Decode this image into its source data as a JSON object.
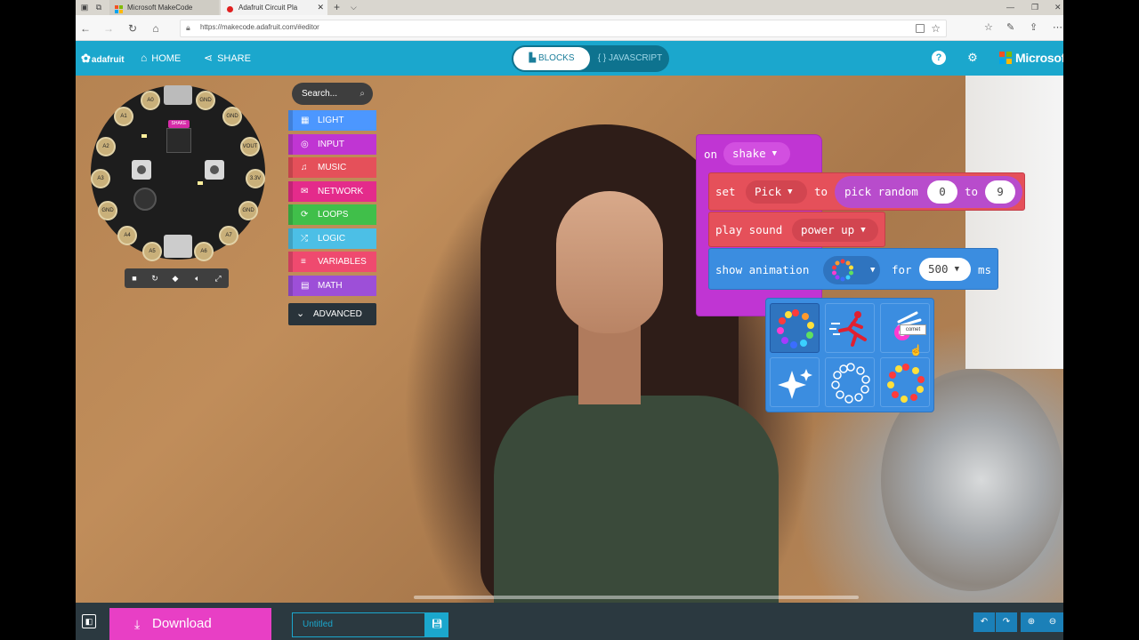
{
  "browser": {
    "tabs": [
      {
        "label": "Microsoft MakeCode"
      },
      {
        "label": "Adafruit Circuit Pla"
      }
    ],
    "new_tab_glyph": "+",
    "url": "https://makecode.adafruit.com/#editor"
  },
  "header": {
    "logo_text": "adafruit",
    "home_label": "HOME",
    "share_label": "SHARE",
    "blocks_label": "BLOCKS",
    "javascript_label": "{ } JAVASCRIPT",
    "microsoft_label": "Microsoft"
  },
  "simulator": {
    "shake_badge": "SHAKE",
    "pads": [
      "A1",
      "A2",
      "A3",
      "GND",
      "A4",
      "A5",
      "A6",
      "A7",
      "GND",
      "3.3V",
      "VOUT",
      "GND",
      "A0",
      "GND"
    ]
  },
  "toolbox": {
    "search_placeholder": "Search...",
    "categories": [
      {
        "label": "LIGHT",
        "color": "#4c97ff"
      },
      {
        "label": "INPUT",
        "color": "#c035d3"
      },
      {
        "label": "MUSIC",
        "color": "#e5505a"
      },
      {
        "label": "NETWORK",
        "color": "#e42b8b"
      },
      {
        "label": "LOOPS",
        "color": "#40bf4a"
      },
      {
        "label": "LOGIC",
        "color": "#4cbfe6"
      },
      {
        "label": "VARIABLES",
        "color": "#ef4a6f"
      },
      {
        "label": "MATH",
        "color": "#9d4fd8"
      }
    ],
    "advanced_label": "ADVANCED"
  },
  "blocks": {
    "on_label": "on",
    "shake_option": "shake",
    "set_label": "set",
    "variable": "Pick",
    "to_label": "to",
    "pick_random_label": "pick random",
    "random_min": "0",
    "random_to_label": "to",
    "random_max": "9",
    "play_sound_label": "play sound",
    "sound_option": "power up",
    "show_animation_label": "show animation",
    "for_label": "for",
    "duration": "500",
    "ms_label": "ms",
    "tooltip": "comet"
  },
  "footer": {
    "download_label": "Download",
    "project_placeholder": "Untitled"
  },
  "colors": {
    "header": "#1ba7cd",
    "download": "#e83fc5",
    "input_block": "#c035d3",
    "music_block": "#e5505a",
    "light_block": "#3b8de0"
  }
}
